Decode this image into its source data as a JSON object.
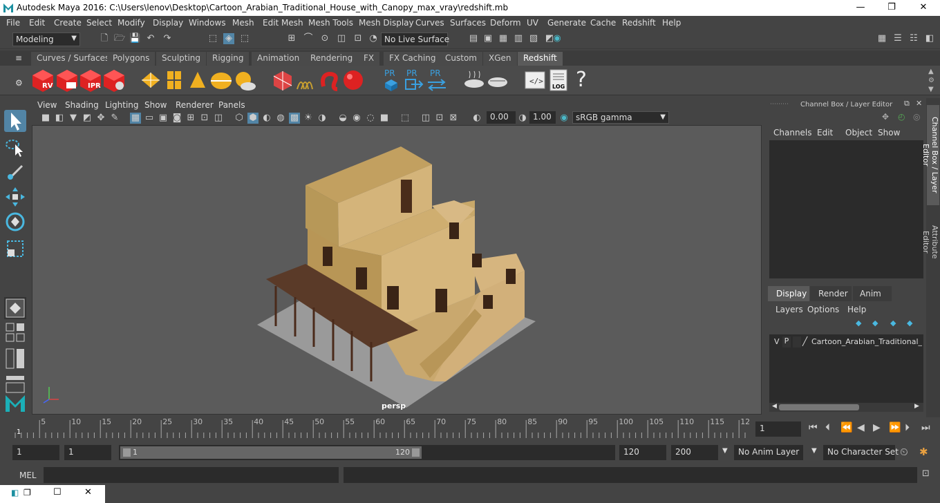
{
  "title": "Autodesk Maya 2016: C:\\Users\\lenov\\Desktop\\Cartoon_Arabian_Traditional_House_with_Canopy_max_vray\\redshift.mb",
  "menu": [
    "File",
    "Edit",
    "Create",
    "Select",
    "Modify",
    "Display",
    "Windows",
    "Mesh",
    "Edit Mesh",
    "Mesh Tools",
    "Mesh Display",
    "Curves",
    "Surfaces",
    "Deform",
    "UV",
    "Generate",
    "Cache",
    "Redshift",
    "Help"
  ],
  "status": {
    "mode": "Modeling",
    "live_surface": "No Live Surface"
  },
  "shelf_tabs": [
    "Curves / Surfaces",
    "Polygons",
    "Sculpting",
    "Rigging",
    "Animation",
    "Rendering",
    "FX",
    "FX Caching",
    "Custom",
    "XGen",
    "Redshift"
  ],
  "shelf_labels": {
    "rv": "RV",
    "ipr": "IPR",
    "pr": "PR",
    "log": "LOG",
    "help": "?"
  },
  "viewport": {
    "menu": [
      "View",
      "Shading",
      "Lighting",
      "Show",
      "Renderer",
      "Panels"
    ],
    "exposure": "0.00",
    "gamma": "1.00",
    "colorspace": "sRGB gamma",
    "camera": "persp"
  },
  "channel_box": {
    "title": "Channel Box / Layer Editor",
    "menu": [
      "Channels",
      "Edit",
      "Object",
      "Show"
    ],
    "layer_tabs": [
      "Display",
      "Render",
      "Anim"
    ],
    "layer_menu": [
      "Layers",
      "Options",
      "Help"
    ],
    "layer": {
      "v": "V",
      "p": "P",
      "name": "Cartoon_Arabian_Traditional_H"
    }
  },
  "side_tabs": [
    "Channel Box / Layer Editor",
    "Attribute Editor"
  ],
  "timeline": {
    "ticks": [
      "5",
      "10",
      "15",
      "20",
      "25",
      "30",
      "35",
      "40",
      "45",
      "50",
      "55",
      "60",
      "65",
      "70",
      "75",
      "80",
      "85",
      "90",
      "95",
      "100",
      "105",
      "110",
      "115",
      "12"
    ],
    "start_marker": "1",
    "current_frame": "1"
  },
  "range": {
    "start": "1",
    "playback_start": "1",
    "slider_start": "1",
    "slider_end": "120",
    "playback_end": "120",
    "end": "200",
    "anim_layer": "No Anim Layer",
    "character_set": "No Character Set"
  },
  "cmd": {
    "label": "MEL"
  },
  "colors": {
    "accent": "#5285a6",
    "active_tab": "#5a5a5a",
    "viewport_bg": "#5b5b5b"
  }
}
